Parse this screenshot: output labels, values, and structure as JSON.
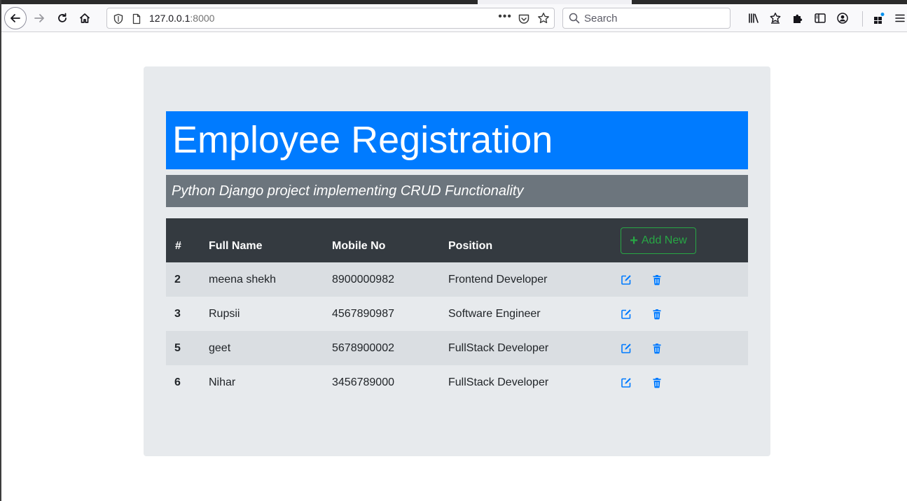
{
  "browser": {
    "url_host": "127.0.0.1",
    "url_port": ":8000",
    "search_placeholder": "Search",
    "more_glyph": "•••"
  },
  "page": {
    "title": "Employee Registration",
    "subtitle": "Python Django project implementing CRUD Functionality"
  },
  "table": {
    "columns": [
      "#",
      "Full Name",
      "Mobile No",
      "Position"
    ],
    "add_button_label": "Add New",
    "rows": [
      {
        "id": "2",
        "name": "meena shekh",
        "mobile": "8900000982",
        "position": "Frontend Developer"
      },
      {
        "id": "3",
        "name": "Rupsii",
        "mobile": "4567890987",
        "position": "Software Engineer"
      },
      {
        "id": "5",
        "name": "geet",
        "mobile": "5678900002",
        "position": "FullStack Developer"
      },
      {
        "id": "6",
        "name": "Nihar",
        "mobile": "3456789000",
        "position": "FullStack Developer"
      }
    ]
  },
  "colors": {
    "primary": "#007bff",
    "secondary": "#6c757d",
    "dark": "#343a40",
    "success": "#28a745",
    "container_bg": "#e7eaed"
  },
  "icons": {
    "edit": "edit-icon",
    "delete": "trash-icon",
    "add": "plus-icon"
  }
}
